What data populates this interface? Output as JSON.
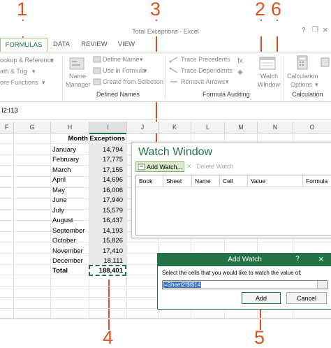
{
  "callouts": [
    "1",
    "3",
    "2",
    "6",
    "4",
    "5"
  ],
  "window": {
    "title": "Total Exceptions - Excel",
    "help": "?",
    "restore": "❐",
    "close": "×"
  },
  "tabs": [
    "FORMULAS",
    "DATA",
    "REVIEW",
    "VIEW"
  ],
  "ribbon": {
    "lookup_reference": "ookup & Reference",
    "math_trig": "ath & Trig",
    "more_functions": "ore Functions",
    "name_manager_1": "Name",
    "name_manager_2": "Manager",
    "define_name": "Define Name",
    "use_in_formula": "Use in Formula",
    "create_from_selection": "Create from Selection",
    "defined_names_label": "Defined Names",
    "trace_precedents": "Trace Precedents",
    "trace_dependents": "Trace Dependents",
    "remove_arrows": "Remove Arrows",
    "formula_auditing_label": "Formula Auditing",
    "watch_window_1": "Watch",
    "watch_window_2": "Window",
    "calc_options_1": "Calculation",
    "calc_options_2": "Options",
    "calculation_label": "Calculation"
  },
  "formula_bar": {
    "name_box": "I2:I13"
  },
  "columns": [
    "F",
    "G",
    "H",
    "I",
    "J",
    "K",
    "L",
    "M",
    "N",
    "O"
  ],
  "table": {
    "header_month": "Month",
    "header_exceptions": "Exceptions",
    "rows": [
      {
        "month": "January",
        "value": "14,794"
      },
      {
        "month": "February",
        "value": "17,775"
      },
      {
        "month": "March",
        "value": "17,155"
      },
      {
        "month": "April",
        "value": "14,696"
      },
      {
        "month": "May",
        "value": "16,006"
      },
      {
        "month": "June",
        "value": "17,940"
      },
      {
        "month": "July",
        "value": "15,579"
      },
      {
        "month": "August",
        "value": "16,437"
      },
      {
        "month": "September",
        "value": "14,193"
      },
      {
        "month": "October",
        "value": "15,826"
      },
      {
        "month": "November",
        "value": "17,410"
      },
      {
        "month": "December",
        "value": "18,111"
      }
    ],
    "total_label": "Total",
    "total_value": "188,401"
  },
  "watch_window": {
    "title": "Watch Window",
    "add_watch": "Add Watch...",
    "delete_watch": "Delete Watch",
    "columns": [
      "Book",
      "Sheet",
      "Name",
      "Cell",
      "Value",
      "Formula"
    ]
  },
  "add_watch_dialog": {
    "title": "Add Watch",
    "help": "?",
    "close": "×",
    "prompt": "Select the cells that you would like to watch the value of:",
    "input_value": "=Sheet2!$I$14",
    "add_label": "Add",
    "cancel_label": "Cancel"
  },
  "colors": {
    "accent": "#217346",
    "callout": "#d9521f"
  }
}
